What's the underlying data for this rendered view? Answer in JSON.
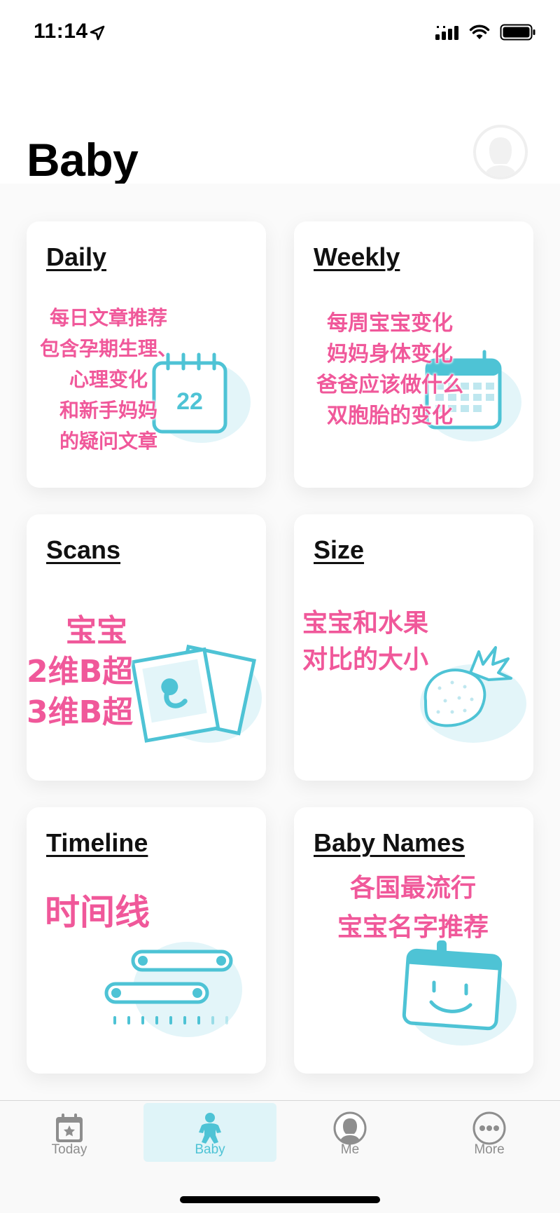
{
  "status_bar": {
    "time": "11:14"
  },
  "header": {
    "title": "Baby"
  },
  "cards": [
    {
      "title": "Daily",
      "note_lines": [
        "每日文章推荐",
        "包含孕期生理、",
        "心理变化",
        "和新手妈妈",
        "的疑问文章"
      ],
      "calendar_number": "22"
    },
    {
      "title": "Weekly",
      "note_lines": [
        "每周宝宝变化",
        "妈妈身体变化",
        "爸爸应该做什么",
        "双胞胎的变化"
      ]
    },
    {
      "title": "Scans",
      "note_lines": [
        "宝宝",
        "2维B超",
        "3维B超"
      ]
    },
    {
      "title": "Size",
      "note_lines": [
        "宝宝和水果",
        "对比的大小"
      ]
    },
    {
      "title": "Timeline",
      "note_lines": [
        "时间线"
      ]
    },
    {
      "title": "Baby Names",
      "note_lines": [
        "各国最流行",
        "宝宝名字推荐"
      ]
    }
  ],
  "tabs": [
    {
      "label": "Today",
      "icon": "calendar-star-icon",
      "active": false
    },
    {
      "label": "Baby",
      "icon": "baby-icon",
      "active": true
    },
    {
      "label": "Me",
      "icon": "person-icon",
      "active": false
    },
    {
      "label": "More",
      "icon": "more-dots-icon",
      "active": false
    }
  ],
  "colors": {
    "accent": "#4ec3d5",
    "note_pink": "#f0589a",
    "art_blob": "#e3f5f9"
  }
}
